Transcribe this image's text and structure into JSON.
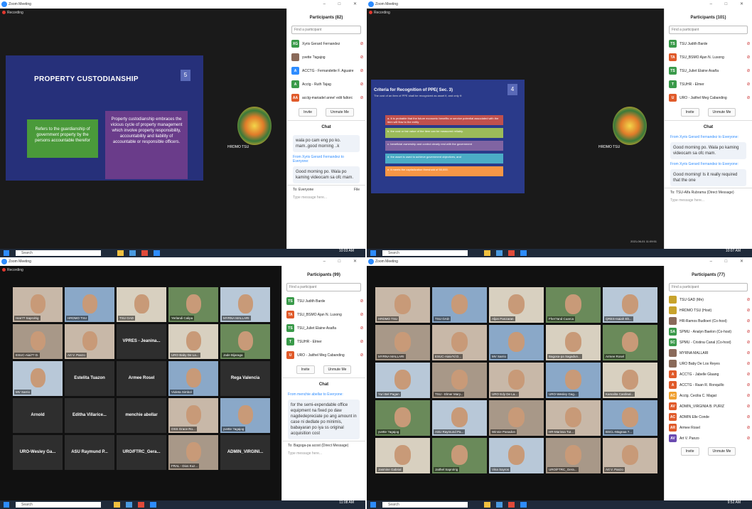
{
  "q1": {
    "title": "Zoom Meeting",
    "recording": "Recording",
    "slide": {
      "title": "PROPERTY CUSTODIANSHIP",
      "number": "5",
      "left_box": "Refers to the guardianship of government property by the persons accountable therefor",
      "right_box": "Property custodianship embraces the vicious cycle of property management which involve property responsibility, accountability and liability of accountable or responsible officers."
    },
    "logo_label": "HRDMO TSU",
    "participants_header": "Participants (82)",
    "search_placeholder": "Find a participant",
    "participants": [
      {
        "initials": "XG",
        "name": "Xyris Gerard Fernandez",
        "color": "#3a9a4a"
      },
      {
        "initials": "",
        "name": "yvette ?agajog",
        "color": "#8a6a5a"
      },
      {
        "initials": "A",
        "name": "ACCTG - Fernandette F. Aguaire",
        "color": "#2d8cff"
      },
      {
        "initials": "A",
        "name": "Acctg - Ruth Tajag",
        "color": "#3a9a4a"
      },
      {
        "initials": "AA",
        "name": "acctg-mariadel anne! edit faltorc",
        "color": "#e05a2a"
      }
    ],
    "invite": "Invite",
    "unmute_me": "Unmute Me",
    "chat_header": "Chat",
    "chat": [
      {
        "from": "",
        "text": "wala po cam eng po ko. mam..good morning ..k"
      },
      {
        "from": "From Xyris Gerard Fernandez to Everyone:",
        "text": "Good morning po. Wala po kaming videocam sa ofc mam."
      }
    ],
    "to": "To: Everyone",
    "file": "File",
    "type_msg": "Type message here...",
    "time": "10:03 AM"
  },
  "q2": {
    "title": "Zoom Meeting",
    "recording": "Recording",
    "slide": {
      "heading": "Criteria for Recognition of PPE( Sec. 3)",
      "sub": "The cost of an item of PPE shall be recognized as asset if, and only if:",
      "number": "4",
      "criteria": [
        {
          "text": "a. It is probable that the future economic benefits or service potential associated with the item will flow to the entity",
          "color": "#c0504d"
        },
        {
          "text": "b. the cost or fair value of the item can be measured reliably.",
          "color": "#9bbb59"
        },
        {
          "text": "c. beneficial ownership and control clearly rest with the government",
          "color": "#8064a2"
        },
        {
          "text": "d. the asset is used to achieve government objectives, and",
          "color": "#4bacc6"
        },
        {
          "text": "e. it meets the capitalization threshold of 50,000.",
          "color": "#f79646"
        }
      ]
    },
    "logo_label": "HRDMO TSU",
    "timestamp": "2021-06-01 11:09:51",
    "participants_header": "Participants (101)",
    "search_placeholder": "Find a participant",
    "participants": [
      {
        "initials": "TS",
        "name": "TSU Judith Barde",
        "color": "#3a9a4a"
      },
      {
        "initials": "TA",
        "name": "TSU_BSMO Ajan N. Lusong",
        "color": "#e05a2a"
      },
      {
        "initials": "TS",
        "name": "TSU_Juliet Elaine Asaña",
        "color": "#3a9a4a"
      },
      {
        "initials": "T",
        "name": "TSUHR - Elmer",
        "color": "#3a9a4a"
      },
      {
        "initials": "U",
        "name": "URO - Jaithel Meg Cabanding",
        "color": "#e05a2a"
      }
    ],
    "invite": "Invite",
    "unmute_me": "Unmute Me",
    "chat_header": "Chat",
    "chat": [
      {
        "from": "From Xyris Gerard Fernandez to Everyone:",
        "text": "Good morning po. Wala po kaming videocam sa ofc mam."
      },
      {
        "from": "From Xyris Gerard Fernandez to Everyone:",
        "text": "Good morning! Is it really required that the one"
      }
    ],
    "to": "To: TSU-Alfa Rubrama (Direct Message)",
    "type_msg": "Type message here...",
    "time": "10:07 AM"
  },
  "q3": {
    "title": "Zoom Meeting",
    "recording": "Recording",
    "tiles": [
      {
        "name": "Hee?? Saprolrig",
        "text": "",
        "photo": true
      },
      {
        "name": "HRDMO TSU",
        "text": "",
        "photo": true
      },
      {
        "name": "TSU GAD",
        "text": "",
        "photo": true
      },
      {
        "name": "Yerlandi Calipa",
        "text": "",
        "photo": true
      },
      {
        "name": "MYRNA MALLARI",
        "text": "",
        "photo": true
      },
      {
        "name": "ESUC-Aiai?? D.",
        "text": "",
        "photo": true
      },
      {
        "name": "Art V. Panzo",
        "text": "",
        "photo": true
      },
      {
        "name": "",
        "text": "VPRES - Jeanina...",
        "photo": false
      },
      {
        "name": "URO Baby De La...",
        "text": "",
        "photo": true
      },
      {
        "name": "Jade Bijaraga",
        "text": "",
        "photo": true
      },
      {
        "name": "MV Sarrio",
        "text": "",
        "photo": true
      },
      {
        "name": "",
        "text": "Estelita Tuazon",
        "photo": false
      },
      {
        "name": "",
        "text": "Armee Rosel",
        "photo": false
      },
      {
        "name": "Violeta Simbol",
        "text": "",
        "photo": true
      },
      {
        "name": "",
        "text": "Rega Valencia",
        "photo": false
      },
      {
        "name": "",
        "text": "Arnold",
        "photo": false
      },
      {
        "name": "",
        "text": "Editha Villarice...",
        "photo": false
      },
      {
        "name": "",
        "text": "menchie abellar",
        "photo": false
      },
      {
        "name": "OSS Grace Ro...",
        "text": "",
        "photo": true
      },
      {
        "name": "yvette ?agajog",
        "text": "",
        "photo": true
      },
      {
        "name": "",
        "text": "URO-Wesley Ga...",
        "photo": false
      },
      {
        "name": "",
        "text": "ASU Raymund P...",
        "photo": false
      },
      {
        "name": "",
        "text": "URO/FTRC_Gera...",
        "photo": false
      },
      {
        "name": "FRAL - Dios Kuz...",
        "text": "",
        "photo": true
      },
      {
        "name": "",
        "text": "ADMIN_VIRGINI...",
        "photo": false
      }
    ],
    "participants_header": "Participants (99)",
    "search_placeholder": "Find a participant",
    "participants": [
      {
        "initials": "TS",
        "name": "TSU Judith Barde",
        "color": "#3a9a4a"
      },
      {
        "initials": "TA",
        "name": "TSU_BSMO Ajan N. Lusong",
        "color": "#e05a2a"
      },
      {
        "initials": "TS",
        "name": "TSU_Juliet Elaine Asaña",
        "color": "#3a9a4a"
      },
      {
        "initials": "T",
        "name": "TSUHR - Elmer",
        "color": "#3a9a4a"
      },
      {
        "initials": "U",
        "name": "URO - Jaithel Meg Cabanding",
        "color": "#e05a2a"
      }
    ],
    "invite": "Invite",
    "unmute_me": "Unmute Me",
    "chat_header": "Chat",
    "chat": [
      {
        "from": "From menchie abellar to Everyone:",
        "text": "for the semi-expendable office equipment na fixed po daw nagdedepreciate po ang amount in case ni dedlate po minimis, babayaran po iya ss original acquisition cost"
      }
    ],
    "to": "To: Bagoga-pa acost (Direct Message)",
    "type_msg": "Type message here...",
    "time": "11:08 AM"
  },
  "q4": {
    "title": "Zoom Meeting",
    "tiles": [
      {
        "name": "HRDMO TSU",
        "text": "",
        "photo": true
      },
      {
        "name": "TSU GAD",
        "text": "",
        "photo": true
      },
      {
        "name": "Aljon Panzaran",
        "text": "",
        "photo": true
      },
      {
        "name": "Fher?and Cuarca",
        "text": "",
        "photo": true
      },
      {
        "name": "QRES-Isaiah Elt...",
        "text": "",
        "photo": true
      },
      {
        "name": "MYRNA MALLARI",
        "text": "",
        "photo": true
      },
      {
        "name": "ESUC-Aiaiv?d D...",
        "text": "",
        "photo": true
      },
      {
        "name": "MV Sarrio",
        "text": "",
        "photo": true
      },
      {
        "name": "Bagosa-pa Sagadun...",
        "text": "",
        "photo": true
      },
      {
        "name": "Armee Rosel",
        "text": "",
        "photo": true
      },
      {
        "name": "Yuri Bel Pagan",
        "text": "",
        "photo": true
      },
      {
        "name": "TSU - Elmer Mary...",
        "text": "",
        "photo": true
      },
      {
        "name": "URO Edy De La...",
        "text": "",
        "photo": true
      },
      {
        "name": "URO-Wesley Gag...",
        "text": "",
        "photo": true
      },
      {
        "name": "Kamalita Cardinal...",
        "text": "",
        "photo": true
      },
      {
        "name": "yvette ?agajog",
        "text": "",
        "photo": true
      },
      {
        "name": "ASU Raymund Pa...",
        "text": "",
        "photo": true
      },
      {
        "name": "Winnie Panadon",
        "text": "",
        "photo": true
      },
      {
        "name": "HR-Marissa TuI...",
        "text": "",
        "photo": true
      },
      {
        "name": "BSCL-Magnaa ?...",
        "text": "",
        "photo": true
      },
      {
        "name": "Jasmine Gabrial",
        "text": "",
        "photo": true
      },
      {
        "name": "Jaithel Saprolrig",
        "text": "",
        "photo": true
      },
      {
        "name": "Vina Sayros",
        "text": "",
        "photo": true
      },
      {
        "name": "URO/FTRC_Gera...",
        "text": "",
        "photo": true
      },
      {
        "name": "Art V. Panzo",
        "text": "",
        "photo": true
      }
    ],
    "participants_header": "Participants (77)",
    "search_placeholder": "Find a participant",
    "participants": [
      {
        "initials": "",
        "name": "TSU GAD (Me)",
        "color": "#c8a32c"
      },
      {
        "initials": "",
        "name": "HRDMO TSU (Host)",
        "color": "#c8a32c"
      },
      {
        "initials": "",
        "name": "HR-Ramos Budloeri (Co-host)",
        "color": "#8a6a5a"
      },
      {
        "initials": "SA",
        "name": "SPMU - Analyn Baelon (Co-host)",
        "color": "#3a9a4a"
      },
      {
        "initials": "SC",
        "name": "SPMU - Cristina Canal (Co-host)",
        "color": "#3a9a4a"
      },
      {
        "initials": "",
        "name": "MYRNA MALLARI",
        "color": "#8a6a5a"
      },
      {
        "initials": "",
        "name": "URO Baby De Los Reyes",
        "color": "#8a6a5a"
      },
      {
        "initials": "A",
        "name": "ACCTG - Jabelle Glaang",
        "color": "#e05a2a"
      },
      {
        "initials": "A",
        "name": "ACCTG - Raan R. Ronquillo",
        "color": "#e05a2a"
      },
      {
        "initials": "AC",
        "name": "Acctg. Cecilia C. Magat",
        "color": "#f0a030"
      },
      {
        "initials": "AV",
        "name": "ADMIN_VIRGINIA B. PURIZ",
        "color": "#e05a2a"
      },
      {
        "initials": "AC",
        "name": "ADMIN Elle Conde",
        "color": "#e05a2a"
      },
      {
        "initials": "AR",
        "name": "Armee Rosel",
        "color": "#e05a2a"
      },
      {
        "initials": "AV",
        "name": "Art V. Panzo",
        "color": "#6a4ab0"
      }
    ],
    "invite": "Invite",
    "unmute_me": "Unmute Me",
    "time": "9:52 AM"
  },
  "taskbar_search": "Search"
}
